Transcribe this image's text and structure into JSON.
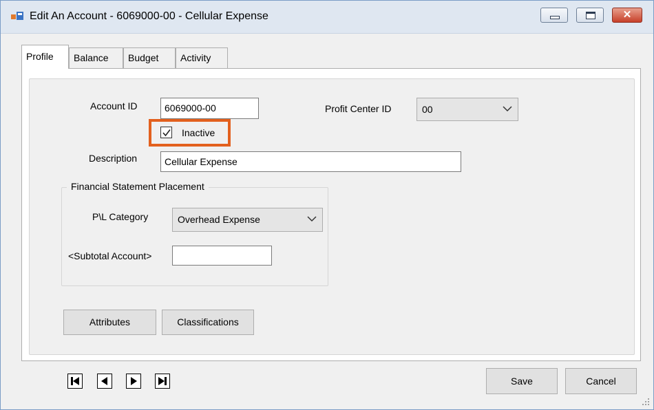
{
  "window": {
    "title": "Edit An Account - 6069000-00 - Cellular Expense",
    "controls": {
      "minimize": "minimize",
      "maximize": "maximize",
      "close": "✕"
    }
  },
  "tabs": [
    {
      "label": "Profile",
      "active": true
    },
    {
      "label": "Balance",
      "active": false
    },
    {
      "label": "Budget",
      "active": false
    },
    {
      "label": "Activity",
      "active": false
    }
  ],
  "profile": {
    "account_id_label": "Account ID",
    "account_id_value": "6069000-00",
    "profit_center_label": "Profit Center ID",
    "profit_center_value": "00",
    "inactive_label": "Inactive",
    "inactive_checked": true,
    "description_label": "Description",
    "description_value": "Cellular Expense",
    "financial_group": {
      "legend": "Financial Statement Placement",
      "pl_category_label": "P\\L Category",
      "pl_category_value": "Overhead Expense",
      "subtotal_label": "<Subtotal Account>",
      "subtotal_value": ""
    },
    "attributes_button": "Attributes",
    "classifications_button": "Classifications"
  },
  "footer": {
    "nav": [
      "first-record-icon",
      "previous-record-icon",
      "next-record-icon",
      "last-record-icon"
    ],
    "save_button": "Save",
    "cancel_button": "Cancel"
  },
  "colors": {
    "highlight": "#e3601e",
    "titlebar": "#dfe7f1",
    "close_button": "#c7402a"
  }
}
